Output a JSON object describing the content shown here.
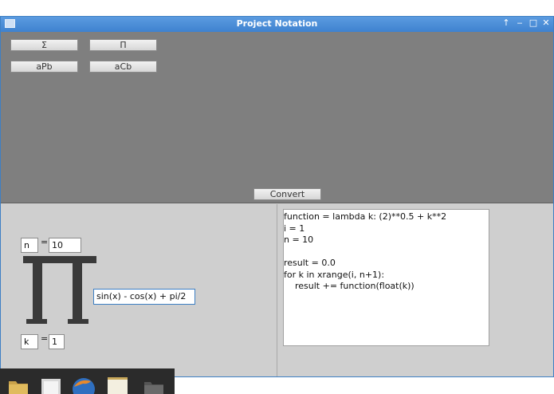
{
  "window": {
    "title": "Project Notation",
    "controls": [
      "↑",
      "‒",
      "□",
      "✕"
    ]
  },
  "toolbar": {
    "buttons": [
      {
        "label": "Σ"
      },
      {
        "label": "Π"
      },
      {
        "label": "aPb"
      },
      {
        "label": "aCb"
      }
    ],
    "convert_label": "Convert"
  },
  "notation": {
    "upper_var": "n",
    "upper_eq": "=",
    "upper_value": "10",
    "function": "sin(x) - cos(x) + pi/2",
    "lower_var": "k",
    "lower_eq": "=",
    "lower_value": "1"
  },
  "code": {
    "lines": [
      "function = lambda k: (2)**0.5 + k**2",
      "i = 1",
      "n = 10",
      "",
      "result = 0.0",
      "for k in xrange(i, n+1):",
      "    result += function(float(k))"
    ]
  },
  "taskbar": {
    "icons": [
      "folder-icon",
      "files-icon",
      "browser-icon",
      "notes-icon",
      "directory-icon"
    ]
  },
  "colors": {
    "accent": "#3d7fc4",
    "toolarea": "#7f7f7f",
    "pane": "#cfcfcf",
    "pi_glyph": "#3a3a3a"
  }
}
